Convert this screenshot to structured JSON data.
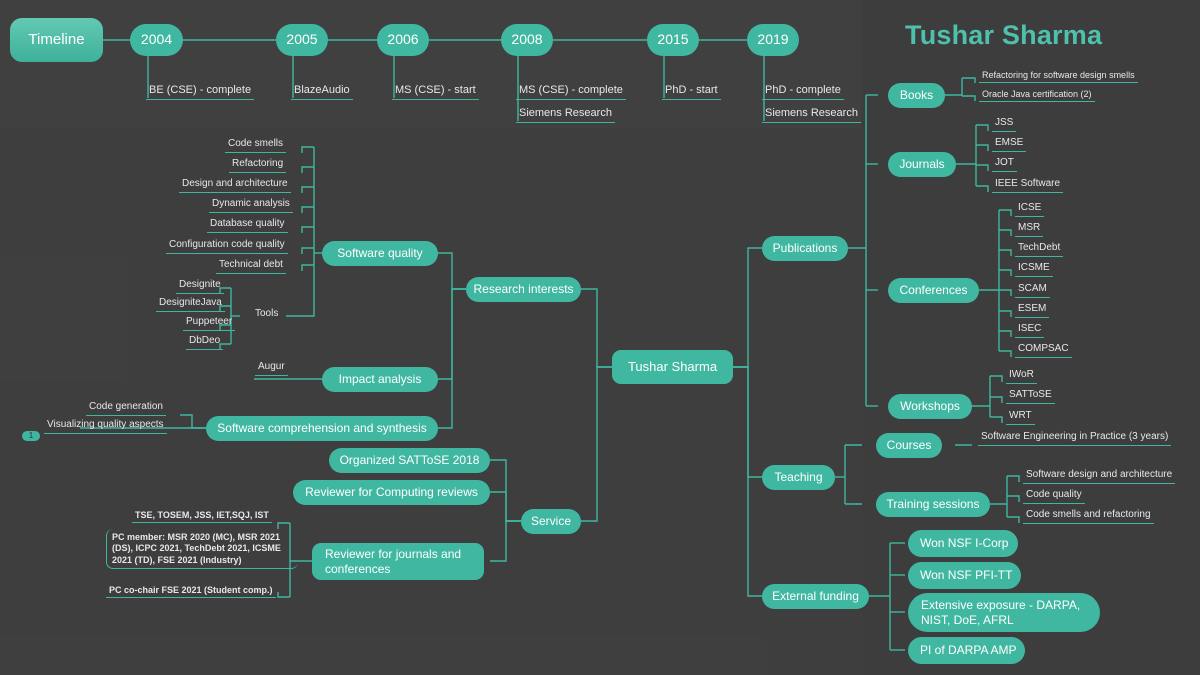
{
  "title": "Tushar Sharma",
  "colors": {
    "background": "#3d3d3d",
    "node_fill": "#40b8a1",
    "link": "#3fb7a0",
    "title_text": "#4ec0ab",
    "node_text": "#ffffff",
    "leaf_text": "#e8e8e8"
  },
  "timeline": {
    "root_label": "Timeline",
    "marker_label": "1",
    "years": [
      {
        "year": "2004",
        "events": [
          "BE (CSE) - complete"
        ]
      },
      {
        "year": "2005",
        "events": [
          "BlazeAudio"
        ]
      },
      {
        "year": "2006",
        "events": [
          "MS (CSE) - start"
        ]
      },
      {
        "year": "2008",
        "events": [
          "MS (CSE) - complete",
          "Siemens Research"
        ]
      },
      {
        "year": "2015",
        "events": [
          "PhD - start"
        ]
      },
      {
        "year": "2019",
        "events": [
          "PhD - complete",
          "Siemens Research"
        ]
      }
    ]
  },
  "center": {
    "label": "Tushar Sharma"
  },
  "branches": {
    "research_interests": {
      "label": "Research interests",
      "children": [
        {
          "label": "Software quality",
          "leaves": [
            "Code smells",
            "Refactoring",
            "Design and architecture",
            "Dynamic analysis",
            "Database quality",
            "Configuration code quality",
            "Technical debt"
          ],
          "sub": {
            "label": "Tools",
            "leaves": [
              "Designite",
              "DesigniteJava",
              "Puppeteer",
              "DbDeo"
            ]
          }
        },
        {
          "label": "Impact analysis",
          "leaves": [
            "Augur"
          ]
        },
        {
          "label": "Software comprehension and synthesis",
          "leaves": [
            "Code generation",
            "Visualizing quality aspects"
          ]
        }
      ]
    },
    "service": {
      "label": "Service",
      "children": [
        {
          "label": "Organized SATToSE 2018"
        },
        {
          "label": "Reviewer for Computing reviews"
        },
        {
          "label": "Reviewer for journals and conferences",
          "leaves": [
            "TSE, TOSEM, JSS, IET,SQJ, IST",
            "PC member: MSR 2020 (MC), MSR 2021 (DS), ICPC 2021, TechDebt 2021, ICSME 2021 (TD), FSE 2021 (Industry)",
            "PC co-chair FSE 2021 (Student comp.)"
          ]
        }
      ]
    },
    "publications": {
      "label": "Publications",
      "children": [
        {
          "label": "Books",
          "leaves": [
            "Refactoring for software design smells",
            "Oracle Java certification (2)"
          ]
        },
        {
          "label": "Journals",
          "leaves": [
            "JSS",
            "EMSE",
            "JOT",
            "IEEE Software"
          ]
        },
        {
          "label": "Conferences",
          "leaves": [
            "ICSE",
            "MSR",
            "TechDebt",
            "ICSME",
            "SCAM",
            "ESEM",
            "ISEC",
            "COMPSAC"
          ]
        },
        {
          "label": "Workshops",
          "leaves": [
            "IWoR",
            "SATToSE",
            "WRT"
          ]
        }
      ]
    },
    "teaching": {
      "label": "Teaching",
      "children": [
        {
          "label": "Courses",
          "leaves": [
            "Software Engineering in Practice (3 years)"
          ]
        },
        {
          "label": "Training sessions",
          "leaves": [
            "Software design and architecture",
            "Code quality",
            "Code smells and refactoring"
          ]
        }
      ]
    },
    "external_funding": {
      "label": "External funding",
      "children": [
        {
          "label": "Won NSF I-Corp"
        },
        {
          "label": "Won NSF PFI-TT"
        },
        {
          "label": "Extensive exposure - DARPA, NIST, DoE, AFRL"
        },
        {
          "label": "PI of DARPA AMP"
        }
      ]
    }
  }
}
